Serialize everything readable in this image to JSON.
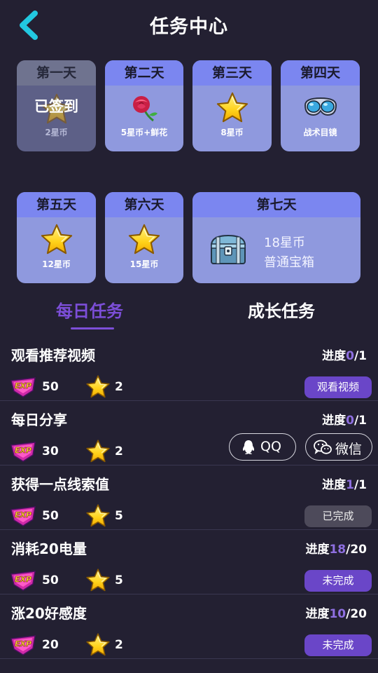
{
  "header": {
    "title": "任务中心"
  },
  "checkin": [
    {
      "day": "第一天",
      "reward": "2星币",
      "status": "已签到",
      "icon": "star-icon"
    },
    {
      "day": "第二天",
      "reward": "5星币+鲜花",
      "icon": "rose-icon"
    },
    {
      "day": "第三天",
      "reward": "8星币",
      "icon": "star-icon"
    },
    {
      "day": "第四天",
      "reward": "战术目镜",
      "icon": "goggles-icon"
    },
    {
      "day": "第五天",
      "reward": "12星币",
      "icon": "star-icon"
    },
    {
      "day": "第六天",
      "reward": "15星币",
      "icon": "star-icon"
    },
    {
      "day": "第七天",
      "reward_line1": "18星币",
      "reward_line2": "普通宝箱",
      "icon": "treasure-chest-icon"
    }
  ],
  "tabs": [
    {
      "label": "每日任务",
      "active": true
    },
    {
      "label": "成长任务",
      "active": false
    }
  ],
  "progress_label": "进度",
  "exp_icon_label": "EXP",
  "tasks": [
    {
      "name": "观看推荐视频",
      "progress_current": "0",
      "progress_total": "/1",
      "exp": "50",
      "stars": "2",
      "action": "观看视频"
    },
    {
      "name": "每日分享",
      "progress_current": "0",
      "progress_total": "/1",
      "exp": "30",
      "stars": "2",
      "share_qq": "QQ",
      "share_wechat": "微信"
    },
    {
      "name": "获得一点线索值",
      "progress_current": "1",
      "progress_total": "/1",
      "exp": "50",
      "stars": "5",
      "action": "已完成"
    },
    {
      "name": "消耗20电量",
      "progress_current": "18",
      "progress_total": "/20",
      "exp": "50",
      "stars": "5",
      "action": "未完成"
    },
    {
      "name": "涨20好感度",
      "progress_current": "10",
      "progress_total": "/20",
      "exp": "20",
      "stars": "2",
      "action": "未完成"
    }
  ],
  "colors": {
    "background": "#232032",
    "card": "#8f99de",
    "card_header": "#7b86f0",
    "accent_purple": "#6a46c8",
    "back_cyan": "#22c8e0"
  }
}
